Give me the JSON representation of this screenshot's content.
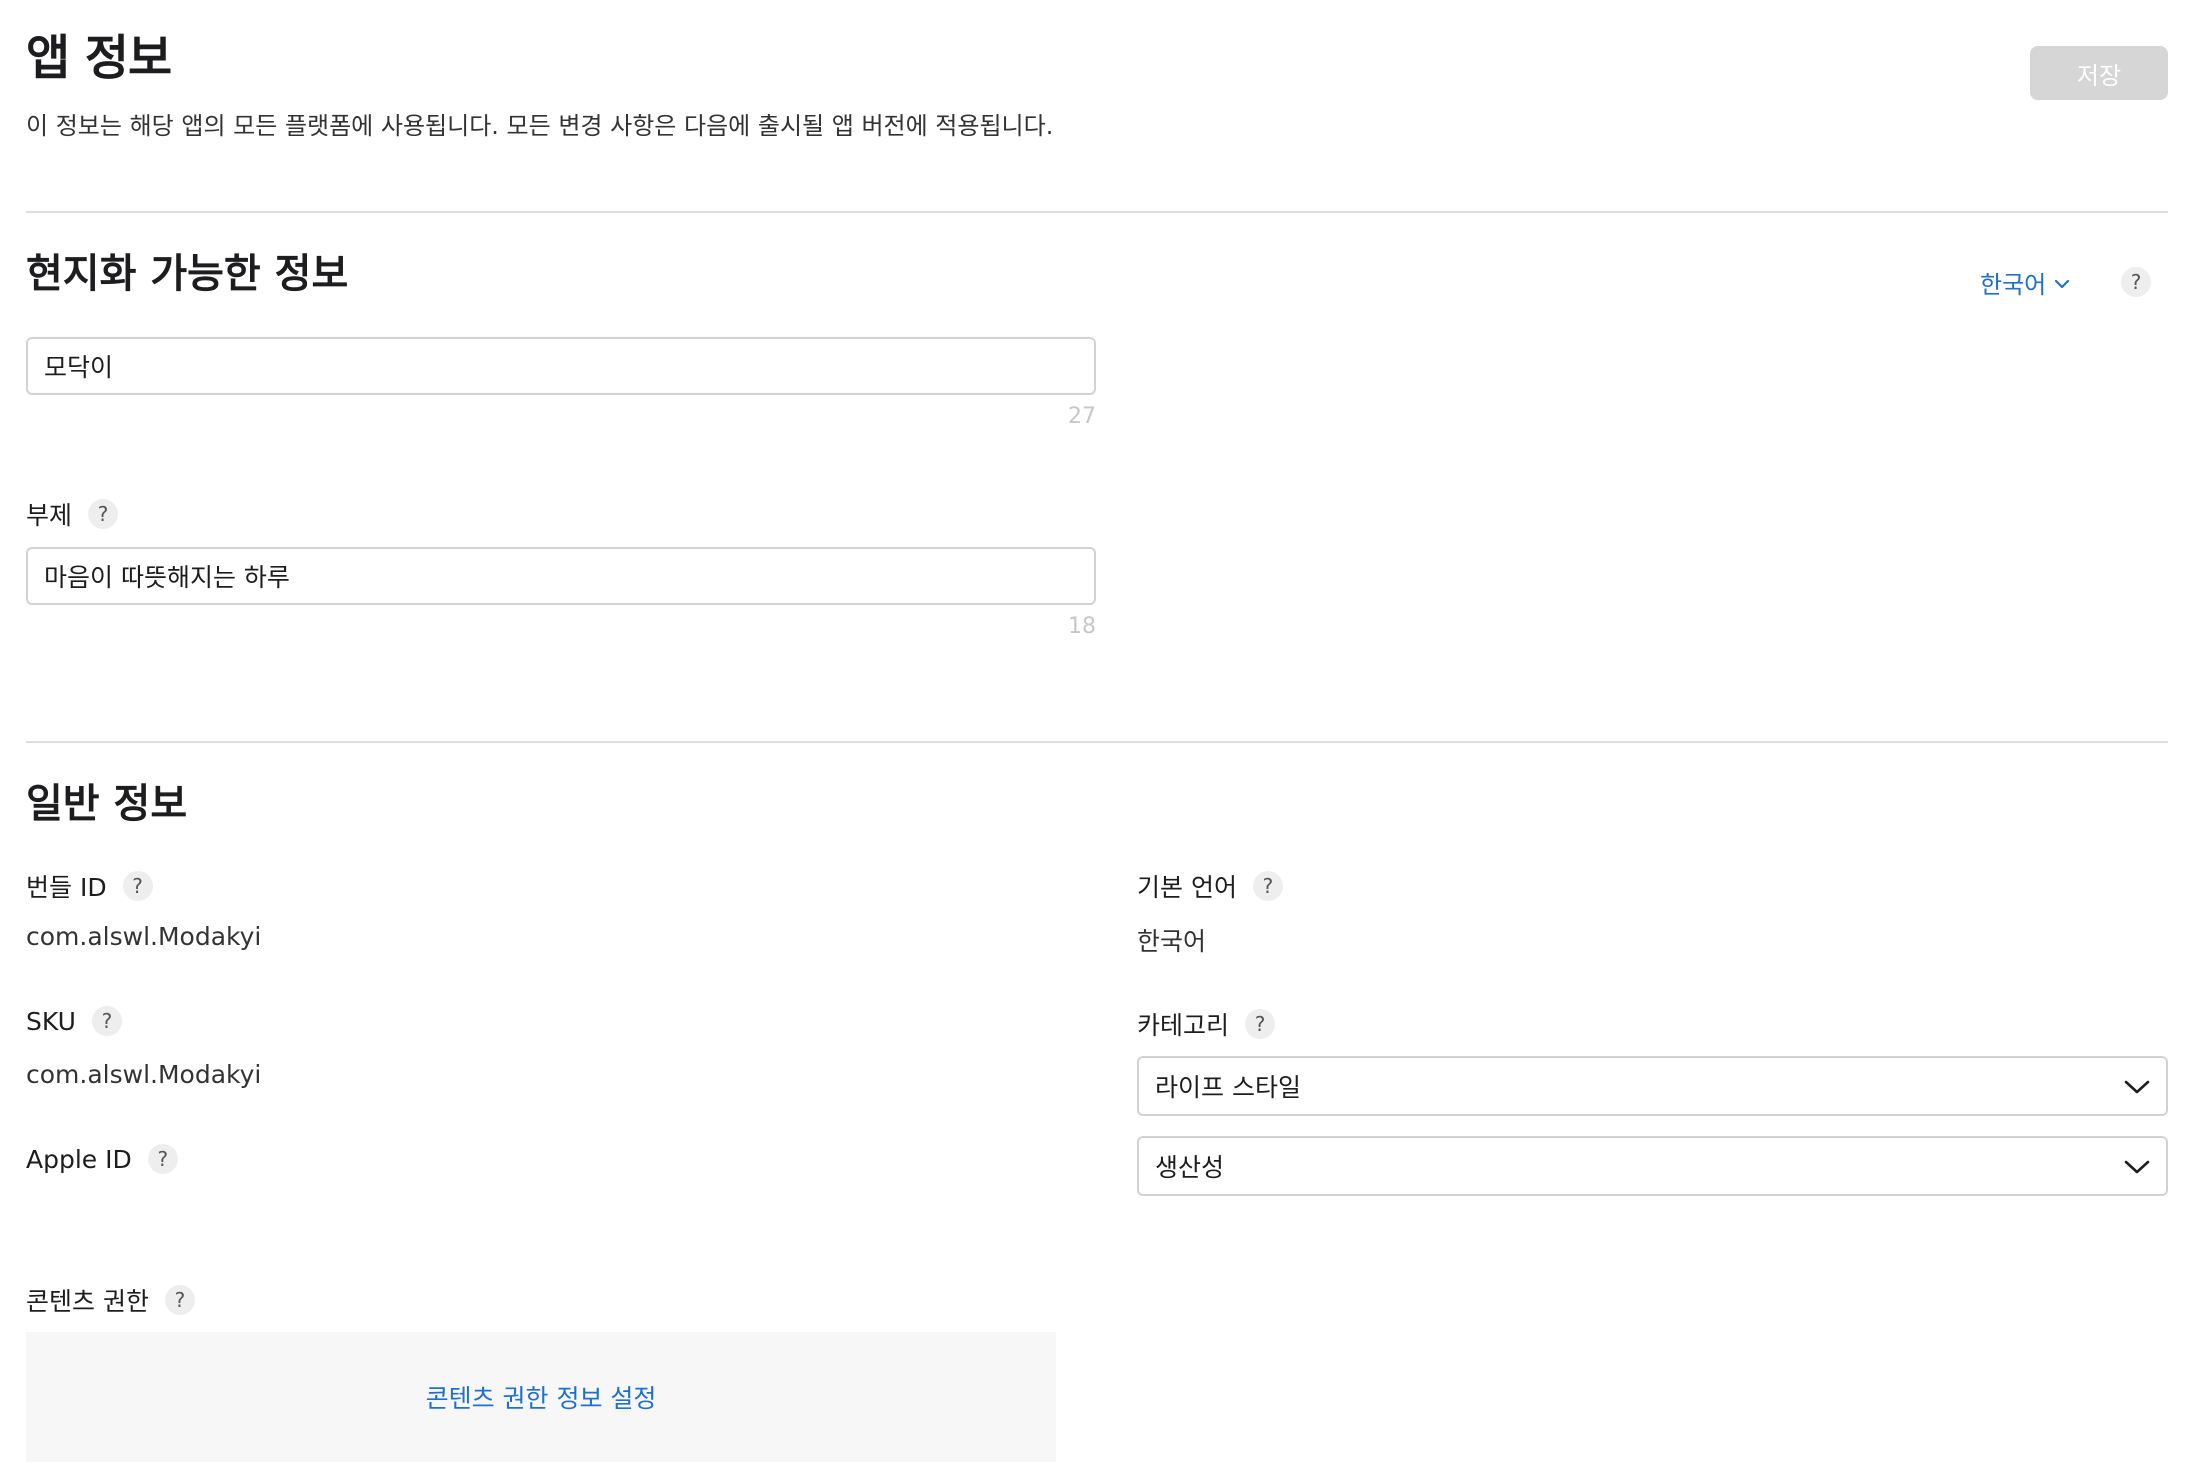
{
  "header": {
    "title": "앱 정보",
    "description": "이 정보는 해당 앱의 모든 플랫폼에 사용됩니다. 모든 변경 사항은 다음에 출시될 앱 버전에 적용됩니다.",
    "save_label": "저장"
  },
  "localizable": {
    "title": "현지화 가능한 정보",
    "language": "한국어",
    "help": "?",
    "name_value": "모닥이",
    "name_remaining": "27",
    "subtitle_label": "부제",
    "subtitle_value": "마음이 따뜻해지는 하루",
    "subtitle_remaining": "18"
  },
  "general": {
    "title": "일반 정보",
    "help": "?",
    "bundle_id_label": "번들 ID",
    "bundle_id_value": "com.alswl.Modakyi",
    "sku_label": "SKU",
    "sku_value": "com.alswl.Modakyi",
    "apple_id_label": "Apple ID",
    "primary_language_label": "기본 언어",
    "primary_language_value": "한국어",
    "category_label": "카테고리",
    "primary_category": "라이프 스타일",
    "secondary_category": "생산성",
    "content_rights_label": "콘텐츠 권한",
    "content_rights_link": "콘텐츠 권한 정보 설정"
  },
  "colors": {
    "link": "#1f6fd1",
    "save_disabled_bg": "#d6d6d6",
    "border": "#d2d2d2",
    "divider": "#dedede"
  },
  "icons": {
    "language_chevron": "chevron-down-icon",
    "select_chevron": "chevron-down-icon",
    "help": "question-mark-icon"
  }
}
